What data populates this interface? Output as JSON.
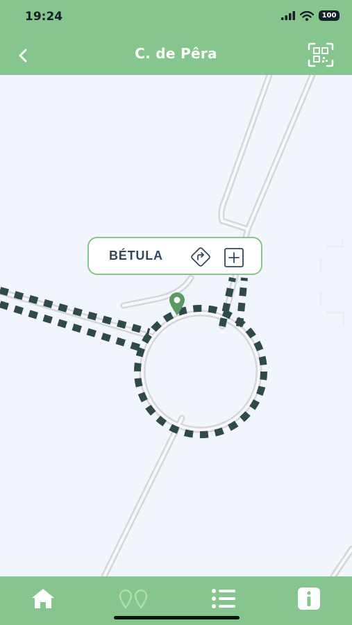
{
  "status_bar": {
    "time": "19:24",
    "battery_level": "100",
    "icons": [
      "cellular-signal-icon",
      "wifi-icon",
      "battery-icon"
    ]
  },
  "header": {
    "title": "C. de Pêra",
    "back_icon": "chevron-left-icon",
    "qr_icon": "qr-code-scan-icon"
  },
  "map": {
    "callout": {
      "name": "BÉTULA",
      "directions_icon": "directions-icon",
      "add_icon": "plus-square-icon"
    },
    "marker_icon": "map-pin-icon"
  },
  "tab_bar": {
    "tabs": [
      {
        "icon": "home-icon",
        "active": true
      },
      {
        "icon": "map-pins-icon",
        "active": false
      },
      {
        "icon": "list-icon",
        "active": false
      },
      {
        "icon": "info-icon",
        "active": false
      }
    ]
  },
  "colors": {
    "accent": "#86c58d",
    "map_background": "#f1f5fc",
    "road": "#d3d6db",
    "route_dash": "#2e4a4b",
    "marker": "#5a9a63",
    "callout_text": "#33475b"
  }
}
